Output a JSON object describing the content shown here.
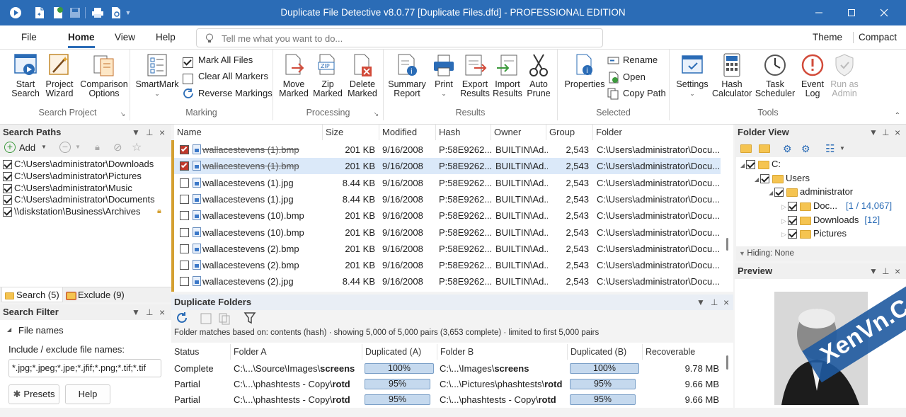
{
  "window": {
    "title": "Duplicate File Detective v8.0.77 [Duplicate Files.dfd] - PROFESSIONAL EDITION"
  },
  "menu": {
    "file": "File",
    "home": "Home",
    "view": "View",
    "help": "Help",
    "tellme_placeholder": "Tell me what you want to do...",
    "theme": "Theme",
    "compact": "Compact"
  },
  "ribbon": {
    "search_project": {
      "label": "Search Project",
      "start_search": [
        "Start",
        "Search"
      ],
      "project_wizard": [
        "Project",
        "Wizard"
      ],
      "comparison_options": [
        "Comparison",
        "Options"
      ]
    },
    "marking": {
      "label": "Marking",
      "smartmark": "SmartMark",
      "mark_all": "Mark All Files",
      "clear_all": "Clear All Markers",
      "reverse": "Reverse Markings"
    },
    "processing": {
      "label": "Processing",
      "move_marked": [
        "Move",
        "Marked"
      ],
      "zip_marked": [
        "Zip",
        "Marked"
      ],
      "delete_marked": [
        "Delete",
        "Marked"
      ]
    },
    "results": {
      "label": "Results",
      "summary_report": [
        "Summary",
        "Report"
      ],
      "print": "Print",
      "export_results": [
        "Export",
        "Results"
      ],
      "import_results": [
        "Import",
        "Results"
      ],
      "auto_prune": [
        "Auto",
        "Prune"
      ]
    },
    "selected": {
      "label": "Selected",
      "properties": "Properties",
      "rename": "Rename",
      "open": "Open",
      "copy_path": "Copy Path"
    },
    "tools": {
      "label": "Tools",
      "settings": "Settings",
      "hash_calculator": [
        "Hash",
        "Calculator"
      ],
      "task_scheduler": [
        "Task",
        "Scheduler"
      ],
      "event_log": [
        "Event",
        "Log"
      ],
      "run_as_admin": [
        "Run as",
        "Admin"
      ]
    }
  },
  "search_paths": {
    "title": "Search Paths",
    "add": "Add",
    "paths": [
      "C:\\Users\\administrator\\Downloads",
      "C:\\Users\\administrator\\Pictures",
      "C:\\Users\\administrator\\Music",
      "C:\\Users\\administrator\\Documents",
      "\\\\diskstation\\Business\\Archives"
    ],
    "tab_search": "Search (5)",
    "tab_exclude": "Exclude (9)"
  },
  "search_filter": {
    "title": "Search Filter",
    "section": "File names",
    "include_label": "Include / exclude file names:",
    "include_value": "*.jpg;*.jpeg;*.jpe;*.jfif;*.png;*.tif;*.tif",
    "presets": "Presets",
    "help": "Help"
  },
  "files": {
    "columns": [
      "Name",
      "Size",
      "Modified",
      "Hash",
      "Owner",
      "Group",
      "Folder"
    ],
    "rows": [
      {
        "checked": true,
        "strike": true,
        "selected": false,
        "name": "wallacestevens (1).bmp",
        "size": "201 KB",
        "modified": "9/16/2008",
        "hash": "P:58E9262...",
        "owner": "BUILTIN\\Ad...",
        "group": "2,543",
        "folder": "C:\\Users\\administrator\\Docu..."
      },
      {
        "checked": true,
        "strike": true,
        "selected": true,
        "name": "wallacestevens (1).bmp",
        "size": "201 KB",
        "modified": "9/16/2008",
        "hash": "P:58E9262...",
        "owner": "BUILTIN\\Ad...",
        "group": "2,543",
        "folder": "C:\\Users\\administrator\\Docu..."
      },
      {
        "checked": false,
        "strike": false,
        "selected": false,
        "name": "wallacestevens (1).jpg",
        "size": "8.44 KB",
        "modified": "9/16/2008",
        "hash": "P:58E9262...",
        "owner": "BUILTIN\\Ad...",
        "group": "2,543",
        "folder": "C:\\Users\\administrator\\Docu..."
      },
      {
        "checked": false,
        "strike": false,
        "selected": false,
        "name": "wallacestevens (1).jpg",
        "size": "8.44 KB",
        "modified": "9/16/2008",
        "hash": "P:58E9262...",
        "owner": "BUILTIN\\Ad...",
        "group": "2,543",
        "folder": "C:\\Users\\administrator\\Docu..."
      },
      {
        "checked": false,
        "strike": false,
        "selected": false,
        "name": "wallacestevens (10).bmp",
        "size": "201 KB",
        "modified": "9/16/2008",
        "hash": "P:58E9262...",
        "owner": "BUILTIN\\Ad...",
        "group": "2,543",
        "folder": "C:\\Users\\administrator\\Docu..."
      },
      {
        "checked": false,
        "strike": false,
        "selected": false,
        "name": "wallacestevens (10).bmp",
        "size": "201 KB",
        "modified": "9/16/2008",
        "hash": "P:58E9262...",
        "owner": "BUILTIN\\Ad...",
        "group": "2,543",
        "folder": "C:\\Users\\administrator\\Docu..."
      },
      {
        "checked": false,
        "strike": false,
        "selected": false,
        "name": "wallacestevens (2).bmp",
        "size": "201 KB",
        "modified": "9/16/2008",
        "hash": "P:58E9262...",
        "owner": "BUILTIN\\Ad...",
        "group": "2,543",
        "folder": "C:\\Users\\administrator\\Docu..."
      },
      {
        "checked": false,
        "strike": false,
        "selected": false,
        "name": "wallacestevens (2).bmp",
        "size": "201 KB",
        "modified": "9/16/2008",
        "hash": "P:58E9262...",
        "owner": "BUILTIN\\Ad...",
        "group": "2,543",
        "folder": "C:\\Users\\administrator\\Docu..."
      },
      {
        "checked": false,
        "strike": false,
        "selected": false,
        "name": "wallacestevens (2).jpg",
        "size": "8.44 KB",
        "modified": "9/16/2008",
        "hash": "P:58E9262...",
        "owner": "BUILTIN\\Ad...",
        "group": "2,543",
        "folder": "C:\\Users\\administrator\\Docu..."
      }
    ]
  },
  "duplicate_folders": {
    "title": "Duplicate Folders",
    "info": "Folder matches based on: contents (hash) · showing 5,000 of 5,000 pairs (3,653 complete) · limited to first 5,000 pairs",
    "columns": [
      "Status",
      "Folder A",
      "Duplicated (A)",
      "Folder B",
      "Duplicated (B)",
      "Recoverable"
    ],
    "rows": [
      {
        "status": "Complete",
        "a_prefix": "C:\\...\\Source\\Images\\",
        "a_bold": "screens",
        "dup_a": "100%",
        "dup_a_pct": 100,
        "b_prefix": "C:\\...\\Images\\",
        "b_bold": "screens",
        "dup_b": "100%",
        "dup_b_pct": 100,
        "recoverable": "9.78 MB"
      },
      {
        "status": "Partial",
        "a_prefix": "C:\\...\\phashtests - Copy\\",
        "a_bold": "rotd",
        "dup_a": "95%",
        "dup_a_pct": 95,
        "b_prefix": "C:\\...\\Pictures\\phashtests\\",
        "b_bold": "rotd",
        "dup_b": "95%",
        "dup_b_pct": 95,
        "recoverable": "9.66 MB"
      },
      {
        "status": "Partial",
        "a_prefix": "C:\\...\\phashtests - Copy\\",
        "a_bold": "rotd",
        "dup_a": "95%",
        "dup_a_pct": 95,
        "b_prefix": "C:\\...\\phashtests - Copy\\",
        "b_bold": "rotd",
        "dup_b": "95%",
        "dup_b_pct": 95,
        "recoverable": "9.66 MB"
      }
    ]
  },
  "folder_view": {
    "title": "Folder View",
    "root": "C:",
    "users": "Users",
    "administrator": "administrator",
    "docs": "Doc...",
    "docs_count": "[1 / 14,067]",
    "downloads": "Downloads",
    "downloads_count": "[12]",
    "pictures": "Pictures",
    "hiding": "Hiding: None"
  },
  "preview": {
    "title": "Preview"
  },
  "watermark": "XenVn.Com"
}
